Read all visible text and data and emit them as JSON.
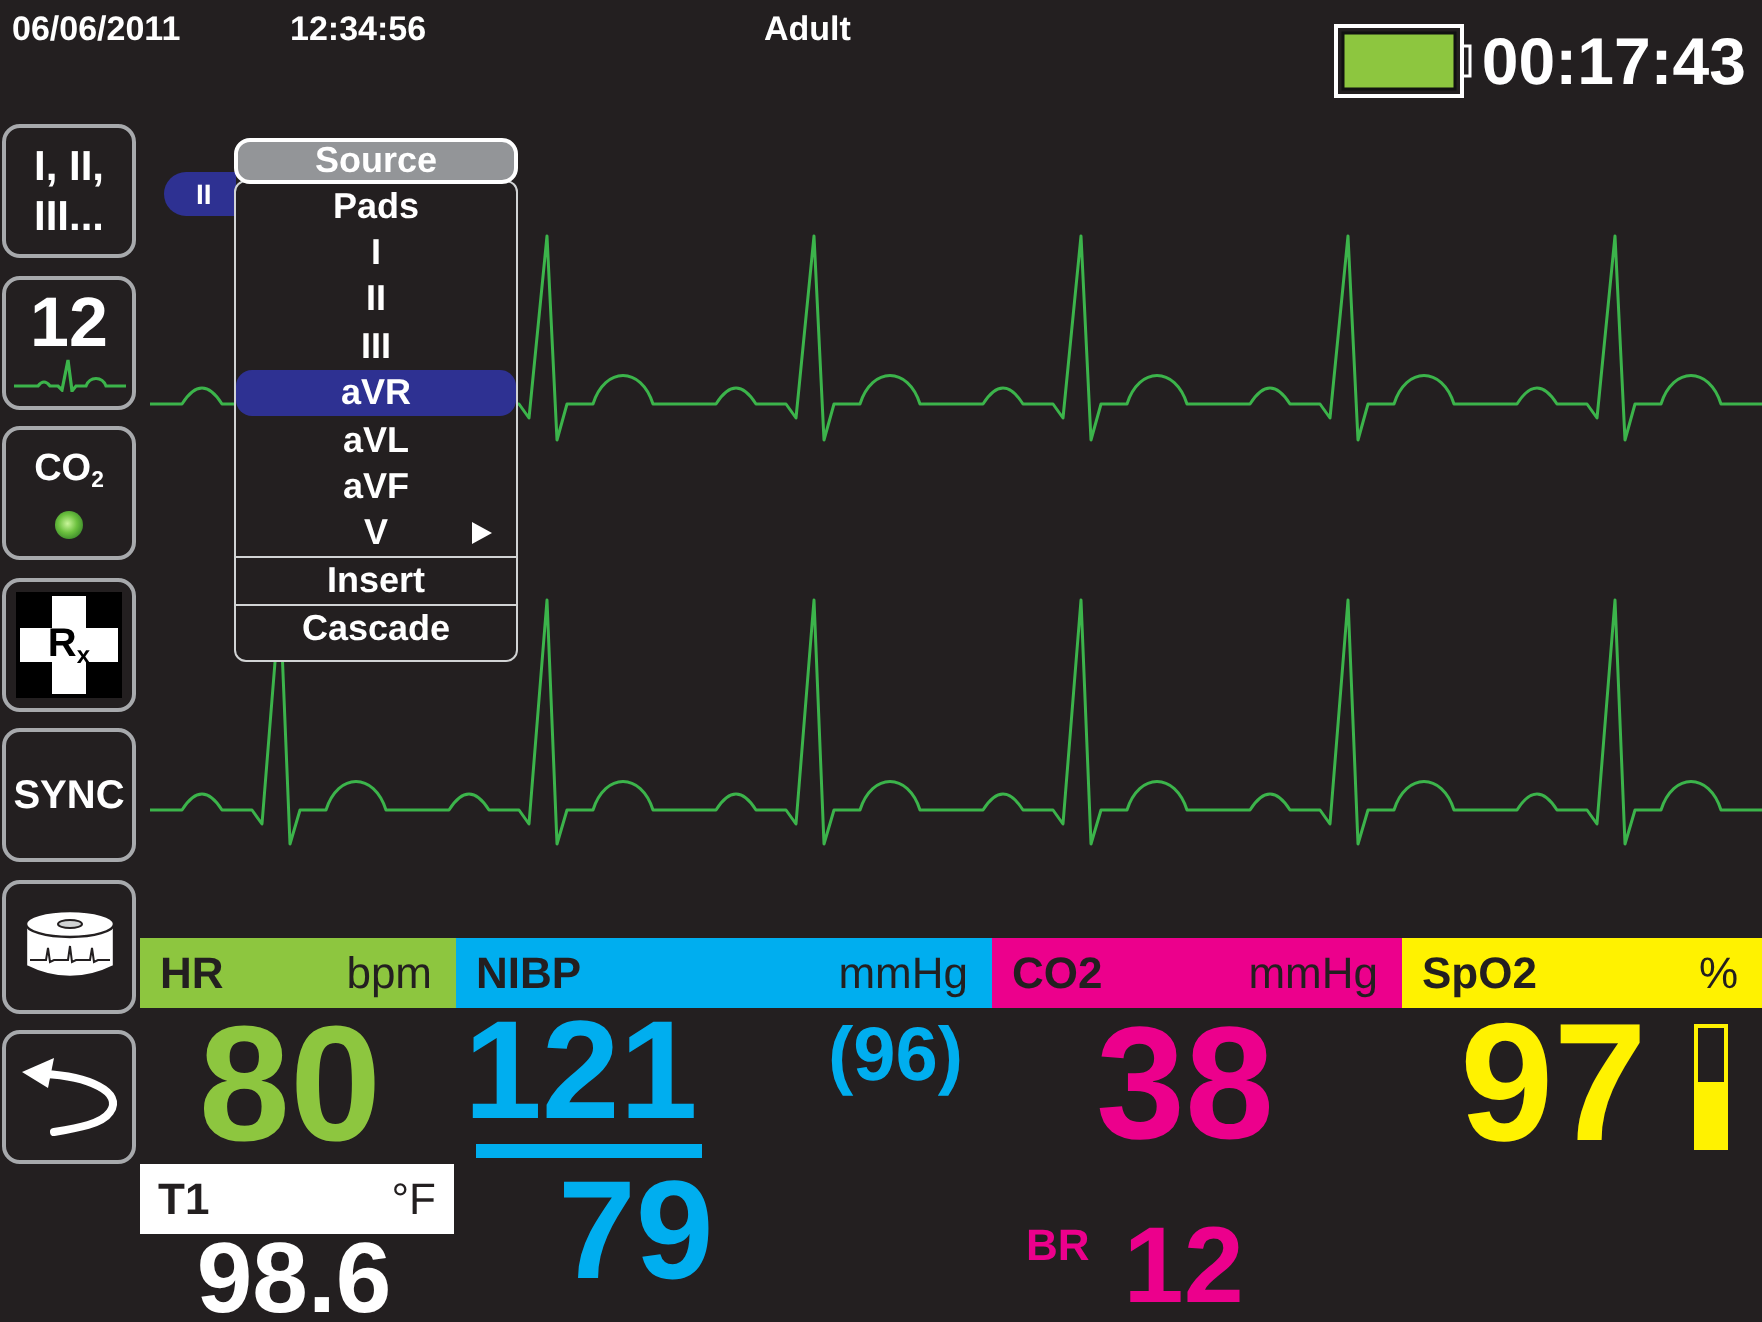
{
  "top_bar": {
    "date": "06/06/2011",
    "time": "12:34:56",
    "patient_type": "Adult",
    "elapsed_time": "00:17:43"
  },
  "sidebar": [
    {
      "kind": "leads",
      "label": "I, II, III..."
    },
    {
      "kind": "twelve",
      "label": "12"
    },
    {
      "kind": "co2",
      "label": "CO$_{2}$",
      "light_on": true
    },
    {
      "kind": "rx",
      "label": "R$_{x}$"
    },
    {
      "kind": "sync",
      "label": "SYNC"
    },
    {
      "kind": "print"
    },
    {
      "kind": "back"
    }
  ],
  "ecg": {
    "lead_label": "II"
  },
  "source_menu": {
    "title": "Source",
    "items": [
      {
        "label": "Pads",
        "kind": "item",
        "selected": false
      },
      {
        "label": "I",
        "kind": "item",
        "selected": false
      },
      {
        "label": "II",
        "kind": "item",
        "selected": false
      },
      {
        "label": "III",
        "kind": "item",
        "selected": false
      },
      {
        "label": "aVR",
        "kind": "item",
        "selected": true
      },
      {
        "label": "aVL",
        "kind": "item",
        "selected": false
      },
      {
        "label": "aVF",
        "kind": "item",
        "selected": false
      },
      {
        "label": "V",
        "kind": "submenu",
        "selected": false
      },
      {
        "label": "Insert",
        "kind": "action",
        "selected": false
      },
      {
        "label": "Cascade",
        "kind": "action",
        "selected": false
      }
    ]
  },
  "vitals": [
    {
      "kind": "hr",
      "label": "HR",
      "unit": "bpm",
      "color": "#8dc63f",
      "value": "80"
    },
    {
      "kind": "nibp",
      "label": "NIBP",
      "unit": "mmHg",
      "color": "#00aeef",
      "systolic": "121",
      "diastolic": "79",
      "mean": "(96)"
    },
    {
      "kind": "co2",
      "label": "CO2",
      "unit": "mmHg",
      "color": "#ec008c",
      "value": "38",
      "br_label": "BR",
      "br_value": "12"
    },
    {
      "kind": "spo2",
      "label": "SpO2",
      "unit": "%",
      "color": "#fff200",
      "value": "97",
      "level": 0.55
    }
  ],
  "temperature": {
    "label": "T1",
    "unit": "°F",
    "value": "98.6"
  }
}
